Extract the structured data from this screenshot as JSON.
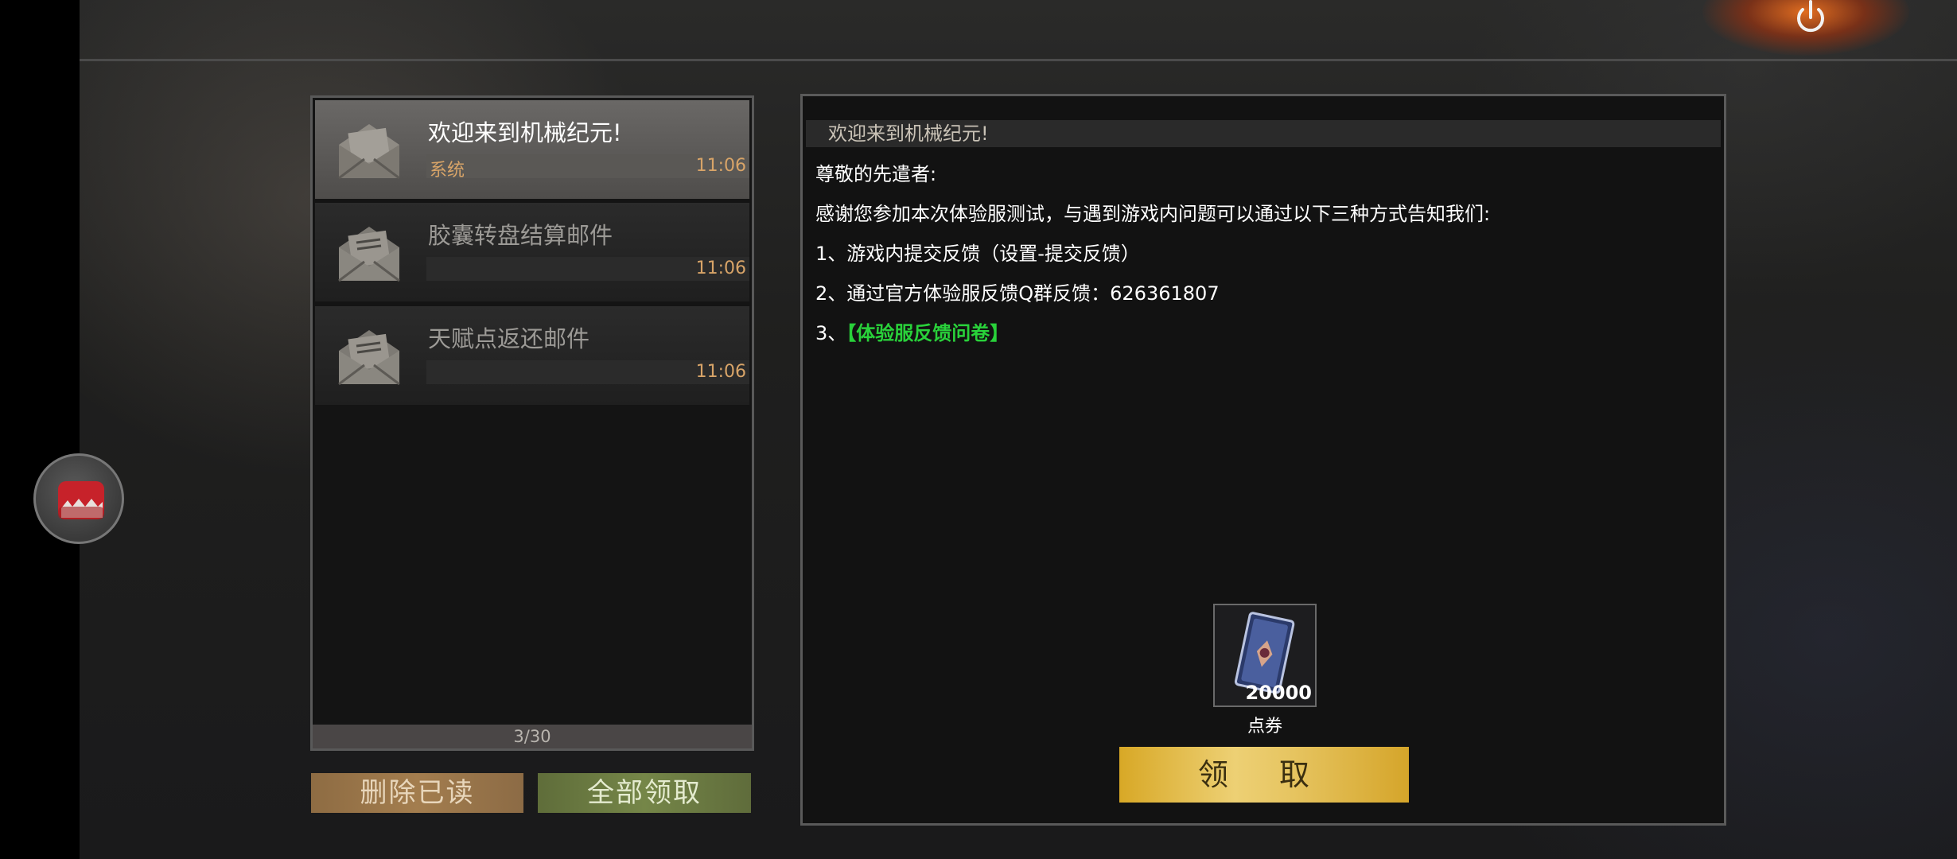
{
  "mail_list": {
    "items": [
      {
        "title": "欢迎来到机械纪元!",
        "sender": "系统",
        "time": "11:06",
        "active": true
      },
      {
        "title": "胶囊转盘结算邮件",
        "sender": "",
        "time": "11:06",
        "active": false
      },
      {
        "title": "天赋点返还邮件",
        "sender": "",
        "time": "11:06",
        "active": false
      }
    ],
    "pager": "3/30"
  },
  "buttons": {
    "delete_read": "删除已读",
    "claim_all": "全部领取",
    "claim": "领 取"
  },
  "mail_detail": {
    "header": "欢迎来到机械纪元!",
    "greeting": "尊敬的先遣者:",
    "body_intro": "感谢您参加本次体验服测试，与遇到游戏内问题可以通过以下三种方式告知我们:",
    "item1": "1、游戏内提交反馈（设置-提交反馈）",
    "item2": "2、通过官方体验服反馈Q群反馈：626361807",
    "item3_prefix": "3、",
    "item3_link": "【体验服反馈问卷】",
    "reward": {
      "count": "20000",
      "name": "点券"
    }
  },
  "colors": {
    "link_green": "#29d13a",
    "time_orange": "#d8a468",
    "claim_gold": "#e6c460"
  },
  "icons": {
    "power": "power-icon",
    "mail": "envelope-icon",
    "side": "monster-mouth-icon"
  }
}
